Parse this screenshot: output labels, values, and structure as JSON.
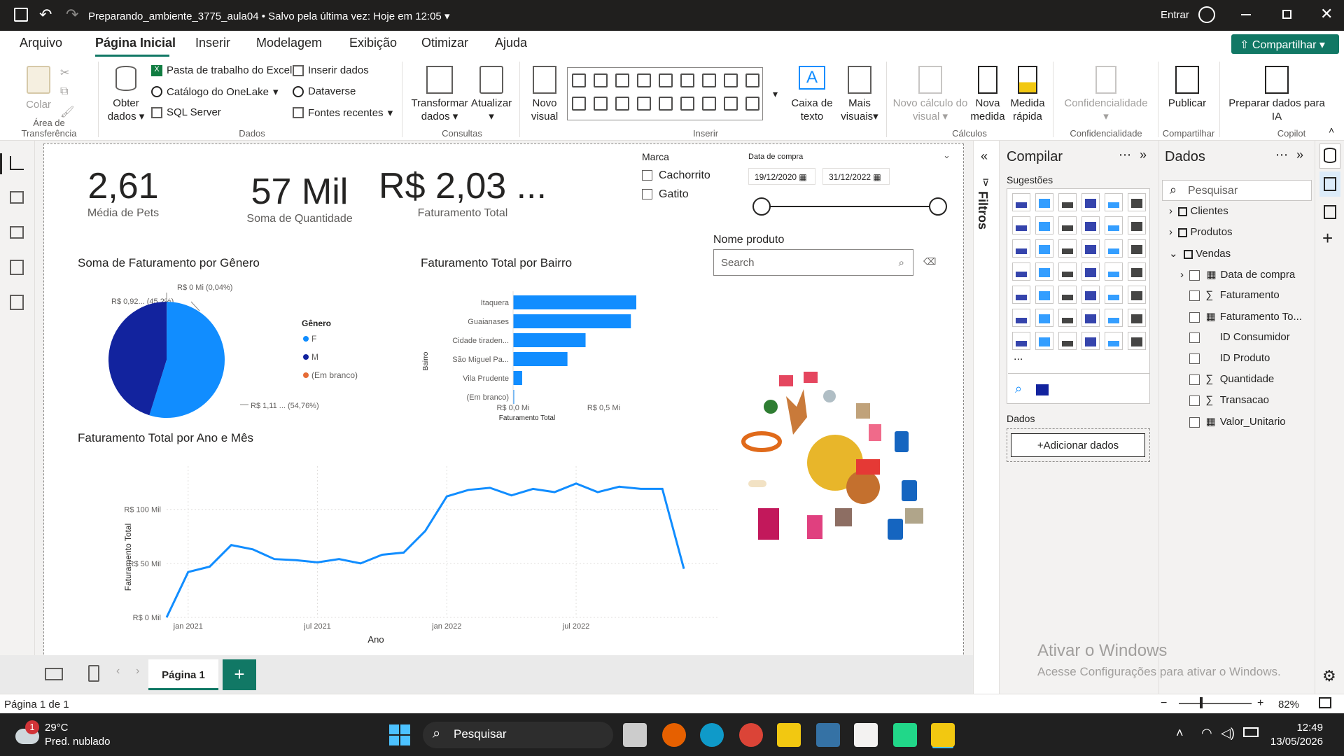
{
  "titlebar": {
    "doc": "Preparando_ambiente_3775_aula04",
    "saved": "Salvo pela última vez: Hoje em 12:05",
    "signin": "Entrar"
  },
  "menu": [
    "Arquivo",
    "Página Inicial",
    "Inserir",
    "Modelagem",
    "Exibição",
    "Otimizar",
    "Ajuda"
  ],
  "share": "Compartilhar",
  "ribbon": {
    "paste": "Colar",
    "clipboard_group": "Área de Transferência",
    "get_data": "Obter",
    "get_data2": "dados",
    "excel": "Pasta de trabalho do Excel",
    "onelake": "Catálogo do OneLake",
    "sql": "SQL Server",
    "insert_data": "Inserir dados",
    "dataverse": "Dataverse",
    "recent": "Fontes recentes",
    "data_group": "Dados",
    "transform": "Transformar",
    "transform2": "dados",
    "refresh": "Atualizar",
    "queries_group": "Consultas",
    "new_visual": "Novo",
    "new_visual2": "visual",
    "textbox": "Caixa de",
    "textbox2": "texto",
    "more_visuals": "Mais",
    "more_visuals2": "visuais",
    "insert_group": "Inserir",
    "new_calc": "Novo cálculo do",
    "new_calc2": "visual",
    "new_measure": "Nova",
    "new_measure2": "medida",
    "quick_measure": "Medida",
    "quick_measure2": "rápida",
    "calc_group": "Cálculos",
    "sensitivity": "Confidencialidade",
    "sensitivity_group": "Confidencialidade",
    "publish": "Publicar",
    "share_group": "Compartilhar",
    "prep_ai": "Preparar dados para",
    "prep_ai2": "IA",
    "copilot_group": "Copilot"
  },
  "kpis": [
    {
      "value": "2,61",
      "label": "Média de Pets"
    },
    {
      "value": "57 Mil",
      "label": "Soma de Quantidade"
    },
    {
      "value": "R$ 2,03 ...",
      "label": "Faturamento Total"
    }
  ],
  "marca": {
    "title": "Marca",
    "options": [
      "Cachorrito",
      "Gatito"
    ]
  },
  "date_slicer": {
    "title": "Data de compra",
    "from": "19/12/2020",
    "to": "31/12/2022"
  },
  "product_slicer": {
    "title": "Nome produto",
    "placeholder": "Search"
  },
  "pie": {
    "title": "Soma de Faturamento por Gênero",
    "legend_title": "Gênero",
    "legend": [
      "F",
      "M",
      "(Em branco)"
    ],
    "label_f": "R$ 1,11 ... (54,76%)",
    "label_m": "R$ 0,92... (45,2%)",
    "label_b": "R$ 0 Mi (0,04%)"
  },
  "chart_data": [
    {
      "type": "pie",
      "title": "Soma de Faturamento por Gênero",
      "categories": [
        "F",
        "M",
        "(Em branco)"
      ],
      "values": [
        54.76,
        45.2,
        0.04
      ],
      "colors": [
        "#118dff",
        "#12239e",
        "#e66c37"
      ],
      "legend_placement": "right"
    },
    {
      "type": "bar",
      "title": "Faturamento Total por Bairro",
      "xlabel": "Faturamento Total",
      "ylabel": "Bairro",
      "categories": [
        "Itaquera",
        "Guaianases",
        "Cidade tiraden...",
        "São Miguel Pa...",
        "Vila Prudente",
        "(Em branco)"
      ],
      "values": [
        0.68,
        0.65,
        0.4,
        0.3,
        0.05,
        0.003
      ],
      "xticks": [
        "R$ 0,0 Mi",
        "R$ 0,5 Mi"
      ],
      "xlim": [
        0,
        0.85
      ],
      "color": "#118dff"
    },
    {
      "type": "line",
      "title": "Faturamento Total por Ano e Mês",
      "xlabel": "Ano",
      "ylabel": "Faturamento Total",
      "xticks": [
        "jan 2021",
        "jul 2021",
        "jan 2022",
        "jul 2022"
      ],
      "yticks": [
        "R$ 0 Mil",
        "R$ 50 Mil",
        "R$ 100 Mil"
      ],
      "ylim": [
        0,
        140
      ],
      "values": [
        0,
        42,
        47,
        67,
        63,
        54,
        53,
        51,
        54,
        50,
        58,
        60,
        80,
        112,
        118,
        120,
        113,
        119,
        116,
        124,
        116,
        121,
        119,
        119,
        45
      ],
      "color": "#118dff"
    }
  ],
  "build": {
    "title": "Compilar",
    "suggestions": "Sugestões",
    "data": "Dados",
    "add_data": "+Adicionar dados",
    "more": "..."
  },
  "filters_label": "Filtros",
  "datapane": {
    "title": "Dados",
    "search": "Pesquisar",
    "tables": [
      {
        "name": "Clientes"
      },
      {
        "name": "Produtos"
      },
      {
        "name": "Vendas"
      }
    ],
    "fields": [
      "Data de compra",
      "Faturamento",
      "Faturamento To...",
      "ID Consumidor",
      "ID Produto",
      "Quantidade",
      "Transacao",
      "Valor_Unitario"
    ]
  },
  "watermark": {
    "l1": "Ativar o Windows",
    "l2": "Acesse Configurações para ativar o Windows."
  },
  "page_tab": "Página 1",
  "status": {
    "page": "Página 1 de 1",
    "zoom": "82%"
  },
  "taskbar": {
    "temp": "29°C",
    "weather": "Pred. nublado",
    "search": "Pesquisar",
    "time": "12:49",
    "date": "13/05/2026",
    "badge": "1"
  }
}
